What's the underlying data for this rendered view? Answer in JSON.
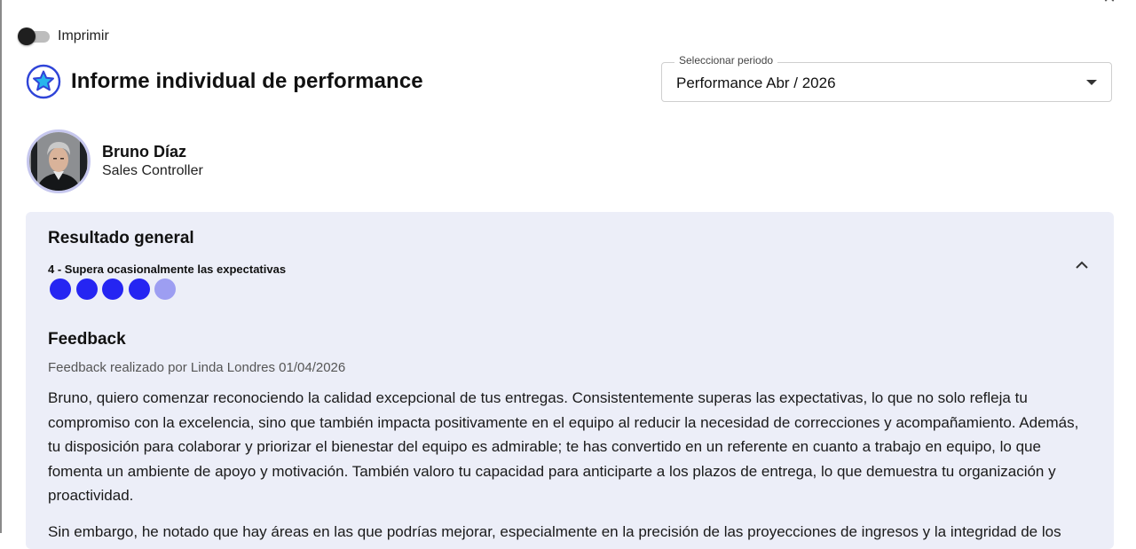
{
  "print": {
    "label": "Imprimir",
    "enabled": false
  },
  "header": {
    "title": "Informe individual de performance",
    "icon": "star-icon"
  },
  "period": {
    "legend": "Seleccionar periodo",
    "value": "Performance Abr / 2026"
  },
  "employee": {
    "name": "Bruno Díaz",
    "role": "Sales Controller"
  },
  "result": {
    "title": "Resultado general",
    "rating_label": "4 - Supera ocasionalmente las expectativas",
    "rating_value": 4,
    "rating_max": 5,
    "colors": {
      "filled": "#2525f2",
      "empty": "#9d9ef2",
      "card_bg": "#eceef8"
    }
  },
  "feedback": {
    "title": "Feedback",
    "meta": "Feedback realizado por Linda Londres 01/04/2026",
    "paragraphs": [
      "Bruno, quiero comenzar reconociendo la calidad excepcional de tus entregas. Consistentemente superas las expectativas, lo que no solo refleja tu compromiso con la excelencia, sino que también impacta positivamente en el equipo al reducir la necesidad de correcciones y acompañamiento. Además, tu disposición para colaborar y priorizar el bienestar del equipo es admirable; te has convertido en un referente en cuanto a trabajo en equipo, lo que fomenta un ambiente de apoyo y motivación. También valoro tu capacidad para anticiparte a los plazos de entrega, lo que demuestra tu organización y proactividad.",
      "Sin embargo, he notado que hay áreas en las que podrías mejorar, especialmente en la precisión de las proyecciones de ingresos y la integridad de los"
    ]
  }
}
